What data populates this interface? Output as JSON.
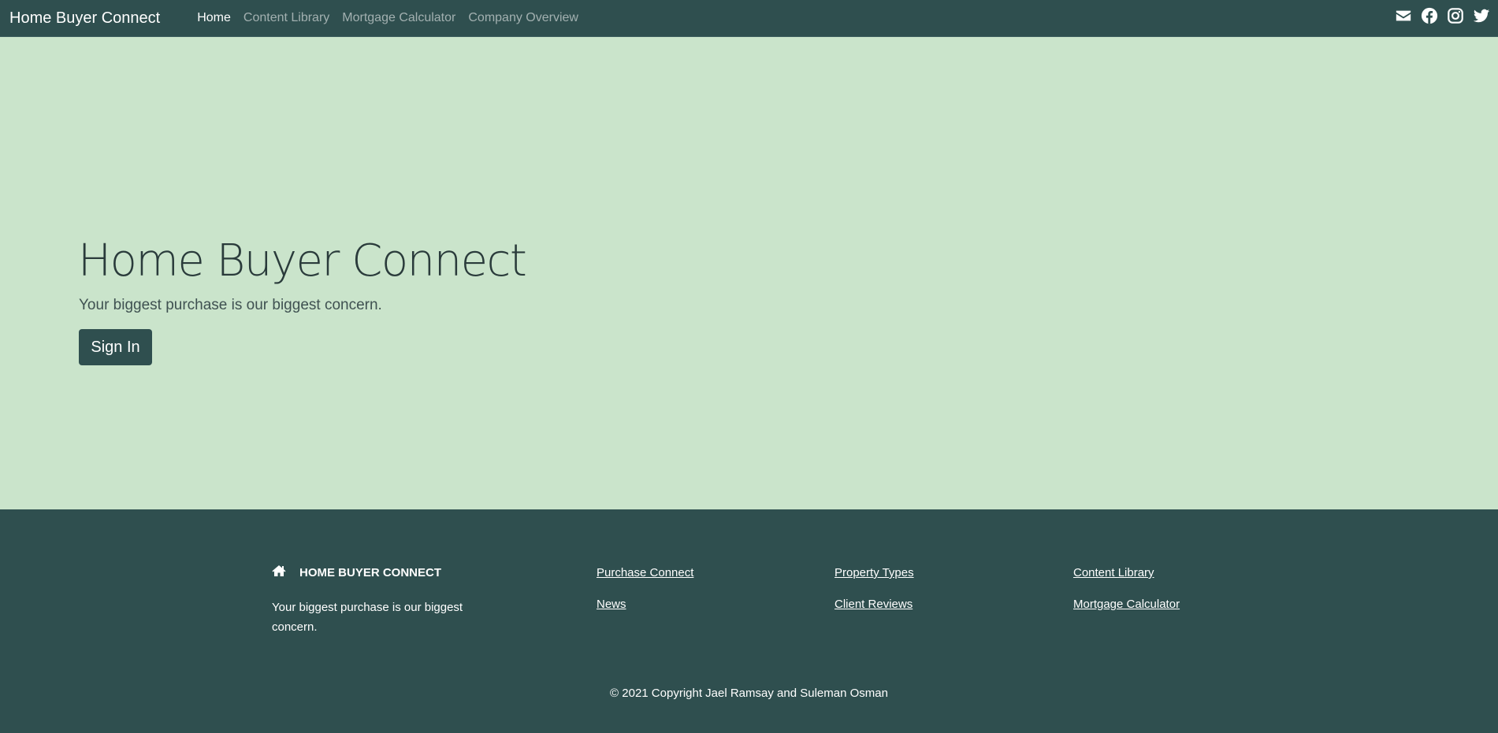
{
  "navbar": {
    "brand": "Home Buyer Connect",
    "links": [
      {
        "label": "Home",
        "active": true
      },
      {
        "label": "Content Library",
        "active": false
      },
      {
        "label": "Mortgage Calculator",
        "active": false
      },
      {
        "label": "Company Overview",
        "active": false
      }
    ],
    "social_icons": [
      "envelope-icon",
      "facebook-icon",
      "instagram-icon",
      "twitter-icon"
    ]
  },
  "hero": {
    "title": "Home Buyer Connect",
    "subtitle": "Your biggest purchase is our biggest concern.",
    "button_label": "Sign In"
  },
  "footer": {
    "brand": "HOME BUYER CONNECT",
    "tagline": "Your biggest purchase is our biggest concern.",
    "links": {
      "purchase_connect": "Purchase Connect",
      "news": "News",
      "property_types": "Property Types",
      "client_reviews": "Client Reviews",
      "content_library": "Content Library",
      "mortgage_calculator": "Mortgage Calculator"
    },
    "copyright": "© 2021 Copyright Jael Ramsay and Suleman Osman"
  },
  "colors": {
    "primary": "#2f4f4f",
    "hero_background": "#cae4cb",
    "text_on_primary": "#ffffff"
  }
}
